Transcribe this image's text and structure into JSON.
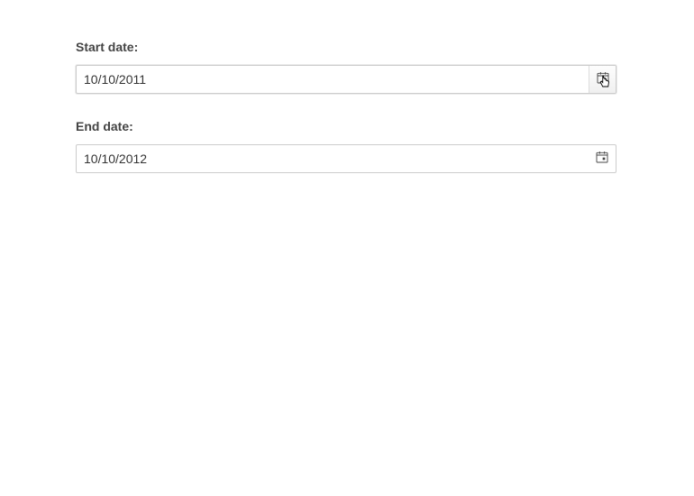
{
  "fields": {
    "start": {
      "label": "Start date:",
      "value": "10/10/2011"
    },
    "end": {
      "label": "End date:",
      "value": "10/10/2012"
    }
  }
}
